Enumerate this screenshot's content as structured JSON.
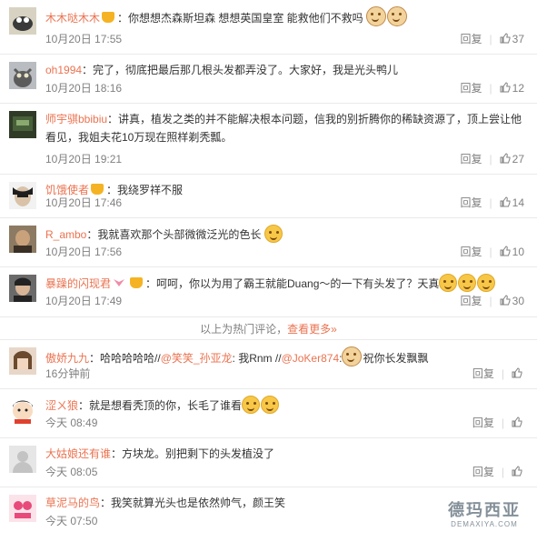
{
  "comments": [
    {
      "user": "木木哒木木",
      "badge": "gold",
      "text": "：你想想杰森斯坦森 想想英国皇室 能救他们不救吗",
      "emoji": [
        "dog",
        "dog"
      ],
      "time": "10月20日 17:55",
      "reply": "回复",
      "likes": "37"
    },
    {
      "user": "oh1994",
      "badge": "",
      "text": "：完了，彻底把最后那几根头发都弄没了。大家好，我是光头鸭儿",
      "emoji": [],
      "time": "10月20日 18:16",
      "reply": "回复",
      "likes": "12"
    },
    {
      "user": "师宇骐bbibiu",
      "badge": "",
      "text": "：讲真，植发之类的并不能解决根本问题，信我的别折腾你的稀缺资源了，顶上尝让他看见，我姐夫花10万现在照样剃秃瓢。",
      "emoji": [],
      "time": "10月20日 19:21",
      "reply": "回复",
      "likes": "27"
    },
    {
      "user": "饥饿使者",
      "badge": "gold",
      "text": "：我绕罗祥不服",
      "emoji": [],
      "time": "10月20日 17:46",
      "reply": "回复",
      "likes": "14"
    },
    {
      "user": "R_ambo",
      "badge": "",
      "text": "：我就喜欢那个头部微微泛光的色长",
      "emoji": [
        "smile"
      ],
      "time": "10月20日 17:56",
      "reply": "回复",
      "likes": "10"
    },
    {
      "user": "暴躁的闪现君",
      "badge": "pink-gold",
      "text": "：呵呵，你以为用了霸王就能Duang～的一下有头发了？天真",
      "emoji": [
        "smile",
        "smile",
        "smile"
      ],
      "time": "10月20日 17:49",
      "reply": "回复",
      "likes": "30"
    }
  ],
  "hot_divider": {
    "text": "以上为热门评论，",
    "more": "查看更多»"
  },
  "recent": [
    {
      "user": "傲娇九九",
      "text": "：哈哈哈哈哈//",
      "mention1": "@笑笑_孙亚龙",
      "text2": ": 我Rnm //",
      "mention2": "@JoKer874",
      "text3": ":",
      "text4": "祝你长发飘飘",
      "time": "16分钟前"
    },
    {
      "user": "涩ㄨ狼",
      "text": "：就是想看秃顶的你，长毛了谁看",
      "time": "今天 08:49"
    },
    {
      "user": "大姑娘还有谁",
      "text": "：方块龙。别把剩下的头发植没了",
      "time": "今天 08:05"
    },
    {
      "user": "草泥马的鸟",
      "text": "：我笑就算光头也是依然帅气，颜王笑",
      "time": "今天 07:50"
    }
  ],
  "watermark": {
    "title": "德玛西亚",
    "sub": "DEMAXIYA.COM"
  },
  "colors": {
    "accent": "#eb7350",
    "meta": "#808080",
    "divider": "#eaeaea"
  }
}
